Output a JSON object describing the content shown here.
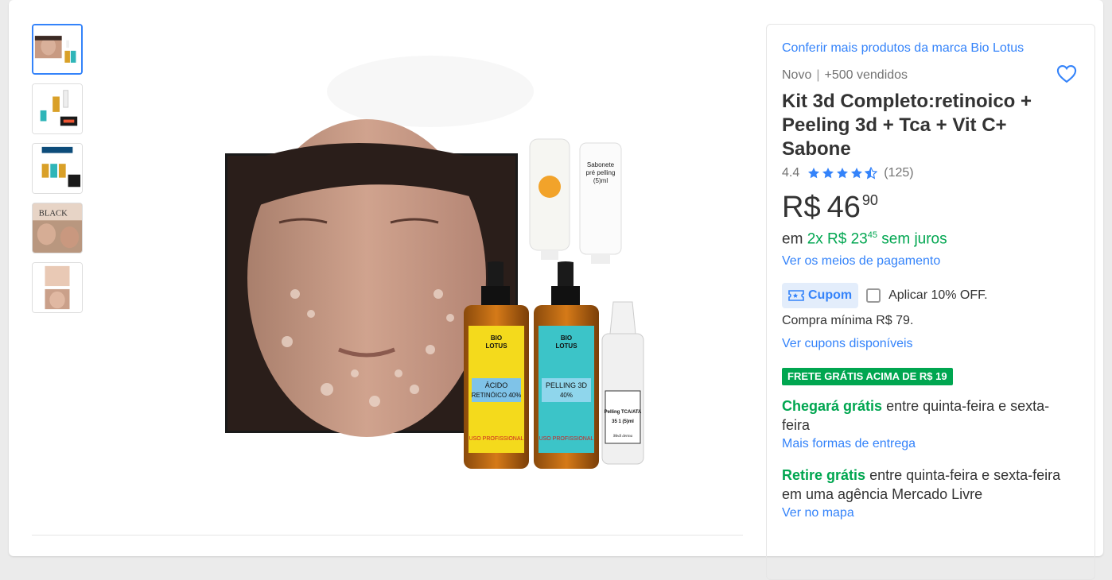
{
  "gallery": {
    "thumbnails": [
      {
        "name": "thumb-face-kit"
      },
      {
        "name": "thumb-kit-products"
      },
      {
        "name": "thumb-kit-bottles"
      },
      {
        "name": "thumb-black-friday"
      },
      {
        "name": "thumb-before-after"
      }
    ]
  },
  "main_image": {
    "bottle1_label": [
      "BIO",
      "LOTUS",
      "ÁCIDO",
      "RETINÓICO 40%",
      "USO PROFISSIONAL"
    ],
    "bottle2_label": [
      "BIO",
      "LOTUS",
      "PELLING 3D",
      "40%",
      "USO PROFISSIONAL"
    ],
    "bottle3_label": [
      "Pelling TCA/ATA",
      "35 1 (5)ml",
      "Medi derma"
    ],
    "tube2_label": [
      "Sabonete",
      "pré pelling",
      "(5)ml"
    ]
  },
  "product": {
    "brand_link": "Conferir mais produtos da marca Bio Lotus",
    "condition": "Novo",
    "separator": "|",
    "sold": "+500 vendidos",
    "title": "Kit 3d Completo:retinoico + Peeling 3d + Tca + Vit C+ Sabone",
    "rating_value": "4.4",
    "rating_count": "(125)",
    "rating_stars": 4.4
  },
  "price": {
    "currency": "R$",
    "amount": "46",
    "cents": "90",
    "installment_prefix": "em",
    "installment_value": "2x R$ 23",
    "installment_cents": "45",
    "installment_suffix": "sem juros",
    "payment_link": "Ver os meios de pagamento"
  },
  "coupon": {
    "badge": "Cupom",
    "apply_label": "Aplicar 10% OFF.",
    "min_purchase": "Compra mínima R$ 79.",
    "link": "Ver cupons disponíveis"
  },
  "shipping": {
    "badge": "FRETE GRÁTIS ACIMA DE R$ 19",
    "arrival_bold": "Chegará grátis",
    "arrival_text": "entre quinta-feira e sexta-feira",
    "link": "Mais formas de entrega",
    "pickup_bold": "Retire grátis",
    "pickup_text": "entre quinta-feira e sexta-feira em uma agência Mercado Livre",
    "map_link": "Ver no mapa"
  },
  "colors": {
    "link": "#3483fa",
    "green": "#00a650",
    "coupon_bg": "#e3edfb"
  }
}
